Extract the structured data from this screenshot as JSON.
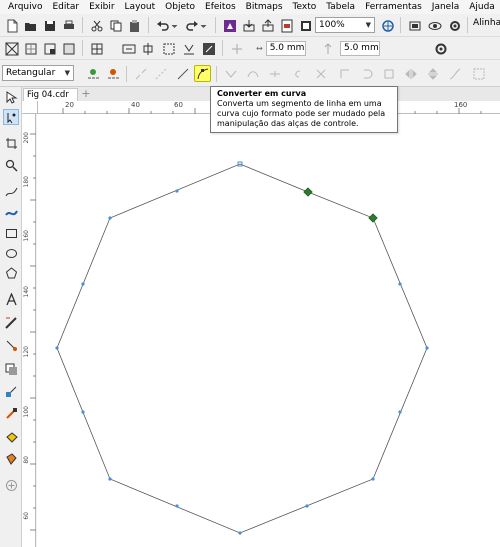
{
  "menu": [
    "Arquivo",
    "Editar",
    "Exibir",
    "Layout",
    "Objeto",
    "Efeitos",
    "Bitmaps",
    "Texto",
    "Tabela",
    "Ferramentas",
    "Janela",
    "Ajuda"
  ],
  "toolbar": {
    "zoom_value": "100%",
    "align_label": "Alinha",
    "nudge_x": "5.0 mm",
    "nudge_y": "5.0 mm"
  },
  "property_bar": {
    "selection_mode": "Retangular"
  },
  "document": {
    "tab_name": "Fig 04.cdr",
    "add_tab_symbol": "+"
  },
  "rulers": {
    "horizontal_ticks": [
      "20",
      "40",
      "60",
      "160"
    ],
    "vertical_ticks": [
      "200",
      "180",
      "160",
      "140",
      "120",
      "100",
      "80",
      "60"
    ]
  },
  "tooltip": {
    "title": "Converter em curva",
    "body": "Converta um segmento de linha em uma curva cujo formato pode ser mudado pela manipulação das alças de controle."
  },
  "colors": {
    "node_selected": "#2d7a2d",
    "node_normal": "#4a90d9",
    "highlight": "#ffff66",
    "toolbar_bg": "#f0f0f0"
  }
}
